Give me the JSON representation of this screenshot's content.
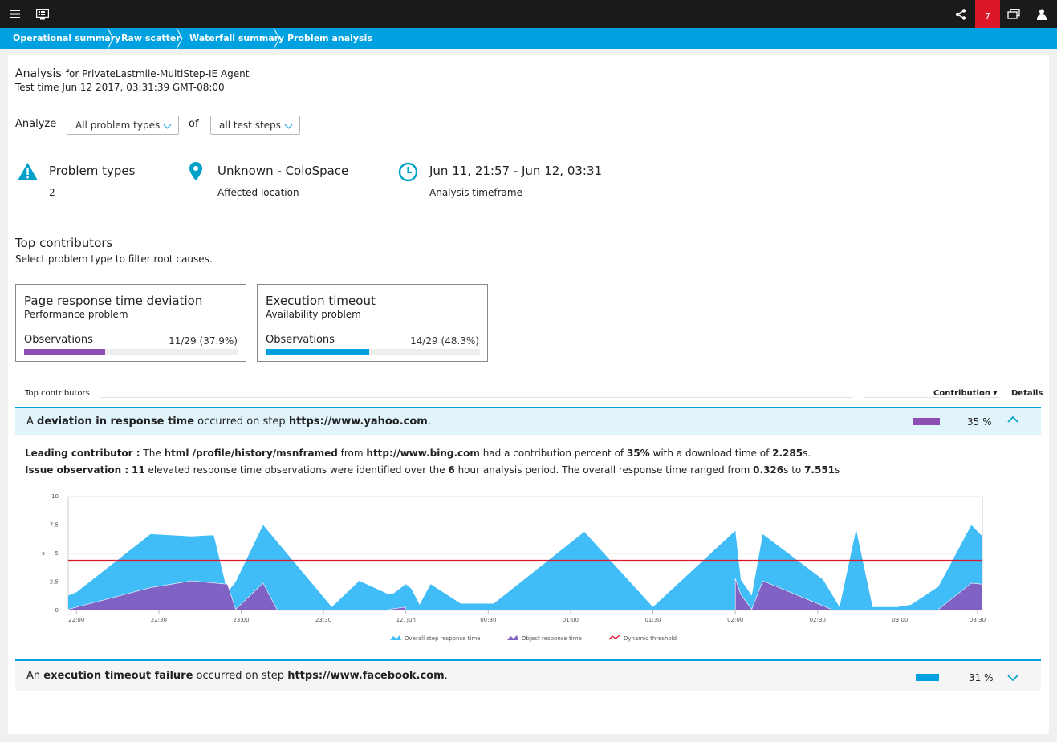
{
  "topbar": {
    "menu_icon": "hamburger-icon",
    "app_icon": "monitor-icon",
    "share_icon": "share-icon",
    "notifications_count": "7",
    "windows_icon": "windows-icon",
    "user_icon": "user-icon",
    "badge_color": "#dc172a"
  },
  "breadcrumb": [
    {
      "label": "Operational summary"
    },
    {
      "label": "Raw scatter"
    },
    {
      "label": "Waterfall summary"
    },
    {
      "label": "Problem analysis"
    }
  ],
  "analysis": {
    "title": "Analysis",
    "for_text": "for PrivateLastmile-MultiStep-IE Agent",
    "test_time": "Test time Jun 12 2017, 03:31:39 GMT-08:00"
  },
  "filters": {
    "analyze_label": "Analyze",
    "problem_type_value": "All problem types",
    "of_label": "of",
    "steps_value": "all test steps"
  },
  "summary": {
    "problem_types": {
      "label": "Problem types",
      "value": "2",
      "icon": "warning-icon"
    },
    "location": {
      "label": "Unknown - ColoSpace",
      "value": "Affected location",
      "icon": "location-pin-icon"
    },
    "timeframe": {
      "label": "Jun 11, 21:57 - Jun 12, 03:31",
      "value": "Analysis timeframe",
      "icon": "clock-icon"
    }
  },
  "top_contributors": {
    "title": "Top contributors",
    "subtitle": "Select problem type to filter root causes.",
    "cards": [
      {
        "title": "Page response time deviation",
        "subtitle": "Performance problem",
        "obs_label": "Observations",
        "obs_value": "11/29 (37.9%)",
        "fraction": 0.379,
        "color": "#8e4fb5"
      },
      {
        "title": "Execution timeout",
        "subtitle": "Availability problem",
        "obs_label": "Observations",
        "obs_value": "14/29 (48.3%)",
        "fraction": 0.483,
        "color": "#00a1e0"
      }
    ]
  },
  "table": {
    "col_top": "Top contributors",
    "col_contribution": "Contribution ▾",
    "col_details": "Details",
    "rows": [
      {
        "pre": "A ",
        "strong1": "deviation in response time",
        "mid": " occurred on step ",
        "strong2": "https://www.yahoo.com",
        "post": ".",
        "percent": "35 %",
        "fraction": 0.35,
        "color": "#8e4fb5",
        "expanded": true
      },
      {
        "pre": "An ",
        "strong1": "execution timeout failure",
        "mid": " occurred on step ",
        "strong2": "https://www.facebook.com",
        "post": ".",
        "percent": "31 %",
        "fraction": 0.31,
        "color": "#00a1e0",
        "expanded": false
      }
    ]
  },
  "details": {
    "lc_label": "Leading contributor :",
    "lc_t1": " The ",
    "lc_b1": "html /profile/history/msnframed",
    "lc_t2": " from ",
    "lc_b2": "http://www.bing.com",
    "lc_t3": " had a contribution percent of ",
    "lc_b3": "35%",
    "lc_t4": " with a download time of ",
    "lc_b4": "2.285",
    "lc_t5": "s.",
    "io_label": "Issue observation :",
    "io_b1": "11",
    "io_t1": " elevated response time observations were identified over the ",
    "io_b2": "6",
    "io_t2": " hour analysis period. The overall response time ranged from ",
    "io_b3": "0.326",
    "io_t3": "s to ",
    "io_b4": "7.551",
    "io_t4": "s"
  },
  "chart_data": {
    "type": "area",
    "ylabel": "s",
    "ylim": [
      0,
      10
    ],
    "yticks": [
      "0",
      "2.5",
      "5",
      "7.5",
      "10"
    ],
    "xticks": [
      "22:00",
      "22:30",
      "23:00",
      "23:30",
      "12. Jun",
      "00:30",
      "01:00",
      "01:30",
      "02:00",
      "02:30",
      "03:00",
      "03:30"
    ],
    "xrange_minutes": [
      -3,
      330
    ],
    "legend_position": "bottom",
    "series": [
      {
        "name": "Overall step response time",
        "color": "#40bdf7",
        "points": [
          [
            -3,
            1.3
          ],
          [
            0,
            1.6
          ],
          [
            27,
            6.7
          ],
          [
            42,
            6.5
          ],
          [
            50,
            6.6
          ],
          [
            55,
            1.6
          ],
          [
            58,
            2.5
          ],
          [
            68,
            7.5
          ],
          [
            93,
            0.3
          ],
          [
            103,
            2.6
          ],
          [
            113,
            1.5
          ],
          [
            115,
            1.4
          ],
          [
            120,
            2.3
          ],
          [
            122,
            1.9
          ],
          [
            125,
            0.5
          ],
          [
            129,
            2.3
          ],
          [
            140,
            0.6
          ],
          [
            152,
            0.6
          ],
          [
            185,
            6.9
          ],
          [
            210,
            0.3
          ],
          [
            240,
            7.0
          ],
          [
            242,
            2.7
          ],
          [
            246,
            1.3
          ],
          [
            250,
            6.7
          ],
          [
            272,
            2.7
          ],
          [
            275,
            1.5
          ],
          [
            278,
            0.3
          ],
          [
            284,
            7.1
          ],
          [
            290,
            0.3
          ],
          [
            299,
            0.3
          ],
          [
            304,
            0.5
          ],
          [
            314,
            2.1
          ],
          [
            326,
            7.5
          ],
          [
            330,
            6.5
          ]
        ]
      },
      {
        "name": "Object response time",
        "color": "#8061c4",
        "segments": [
          [
            [
              -3,
              0.1
            ],
            [
              27,
              2.0
            ],
            [
              42,
              2.6
            ],
            [
              55,
              2.3
            ],
            [
              58,
              0.1
            ],
            [
              68,
              2.4
            ],
            [
              73,
              0.1
            ]
          ],
          [
            [
              114,
              0.1
            ],
            [
              120,
              0.3
            ]
          ],
          [
            [
              240,
              2.8
            ],
            [
              242,
              1.4
            ],
            [
              246,
              0.1
            ],
            [
              250,
              2.6
            ],
            [
              275,
              0.1
            ]
          ],
          [
            [
              314,
              0.1
            ],
            [
              326,
              2.4
            ],
            [
              330,
              2.3
            ]
          ]
        ]
      },
      {
        "name": "Dynamic threshold",
        "color": "#dc172a",
        "value": 4.4
      }
    ]
  }
}
